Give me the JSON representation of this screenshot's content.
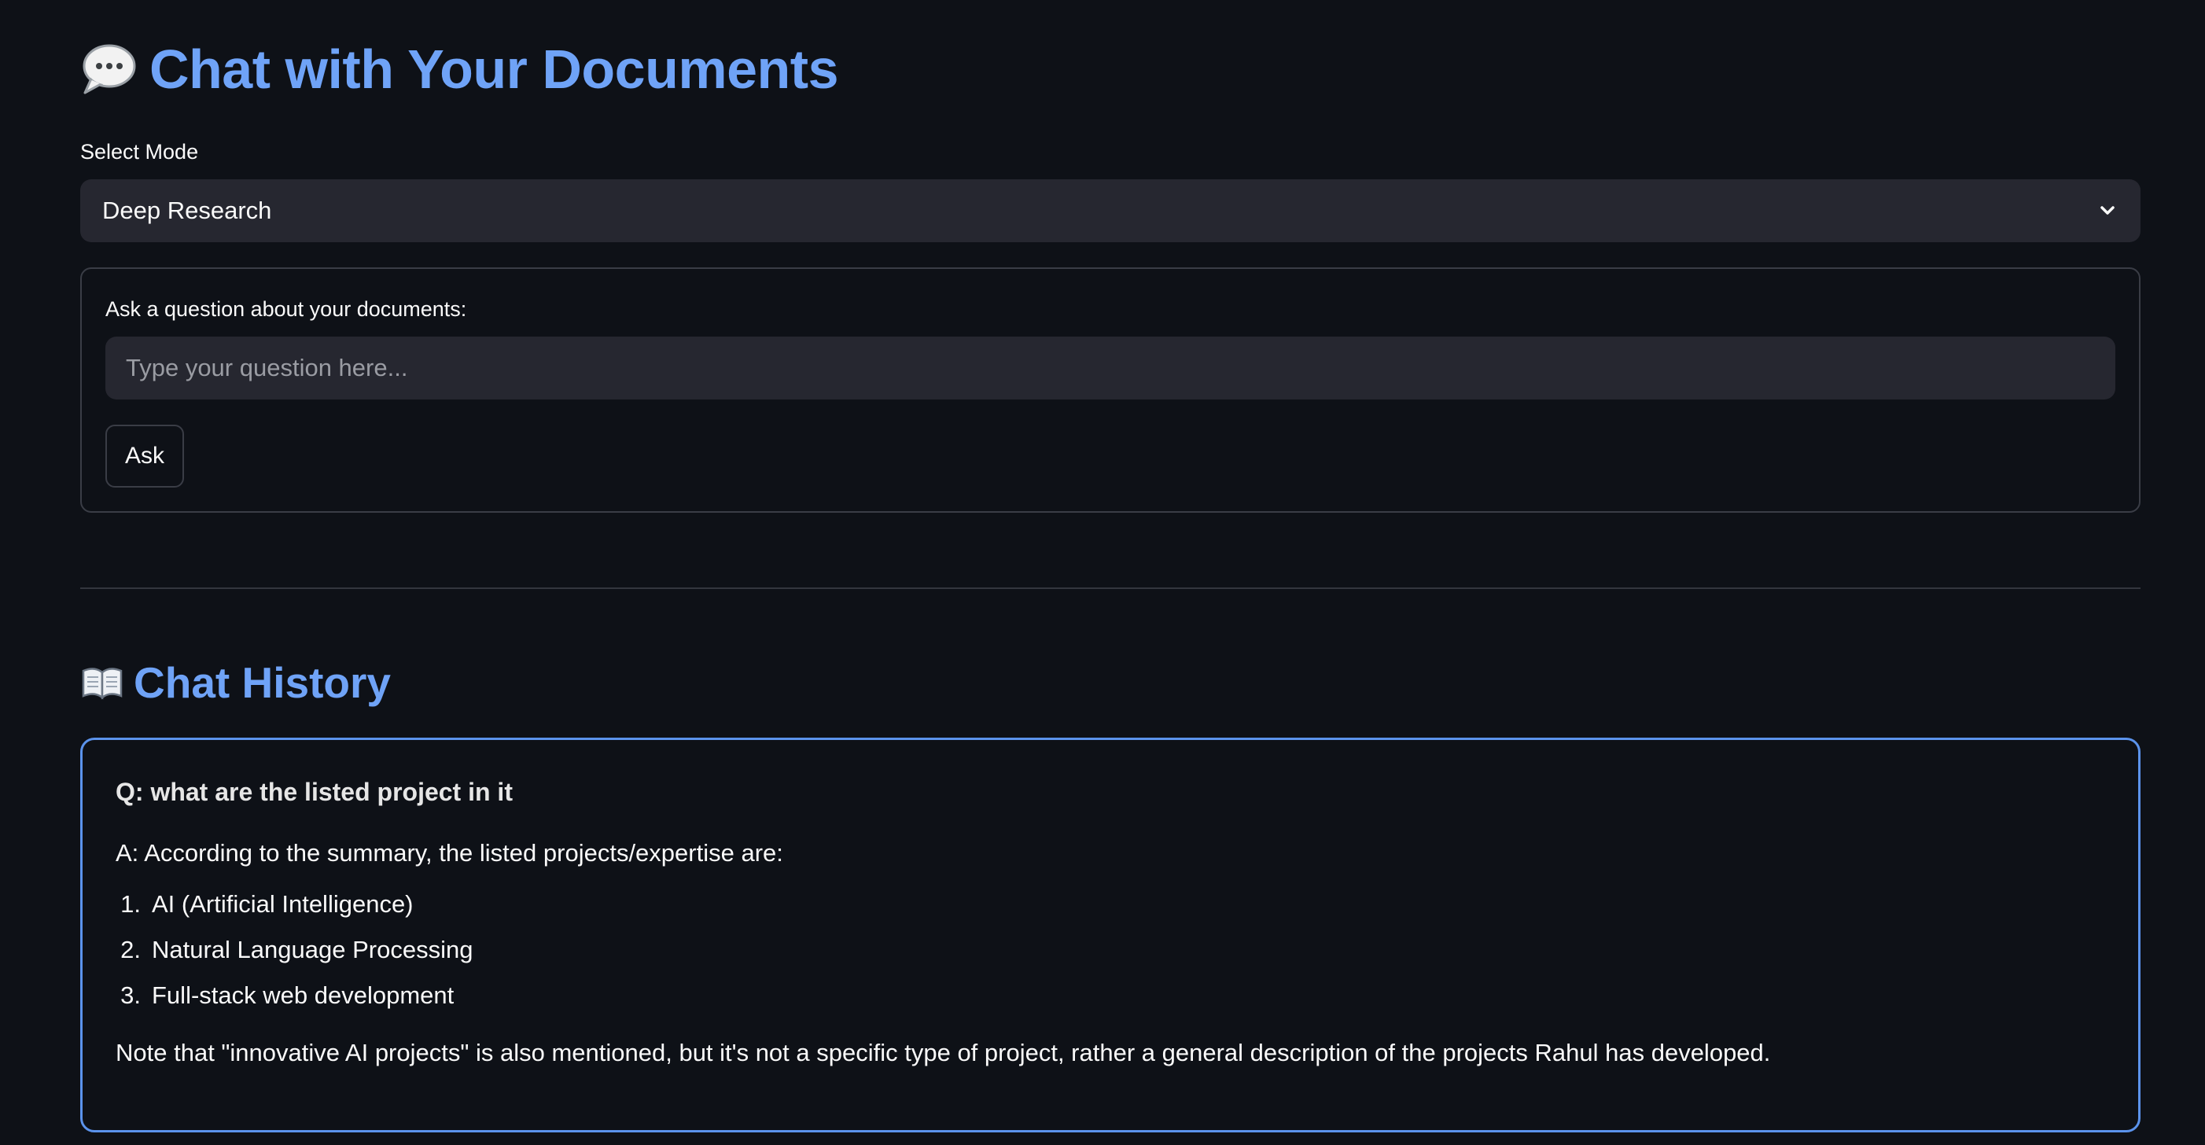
{
  "header": {
    "title": "Chat with Your Documents",
    "icon": "speech-bubble-icon"
  },
  "mode_select": {
    "label": "Select Mode",
    "value": "Deep Research",
    "icon": "chevron-down-icon"
  },
  "question_form": {
    "label": "Ask a question about your documents:",
    "placeholder": "Type your question here...",
    "value": "",
    "submit_label": "Ask"
  },
  "history": {
    "title": "Chat History",
    "icon": "open-book-icon",
    "entries": [
      {
        "question": "Q: what are the listed project in it",
        "answer_intro": "A: According to the summary, the listed projects/expertise are:",
        "answer_items": [
          {
            "num": "1.",
            "text": "AI (Artificial Intelligence)"
          },
          {
            "num": "2.",
            "text": "Natural Language Processing"
          },
          {
            "num": "3.",
            "text": "Full-stack web development"
          }
        ],
        "note": "Note that \"innovative AI projects\" is also mentioned, but it's not a specific type of project, rather a general description of the projects Rahul has developed."
      }
    ]
  },
  "colors": {
    "background": "#0e1117",
    "accent": "#6fa3f7",
    "card_border": "#5b93ec",
    "input_bg": "#262730"
  }
}
